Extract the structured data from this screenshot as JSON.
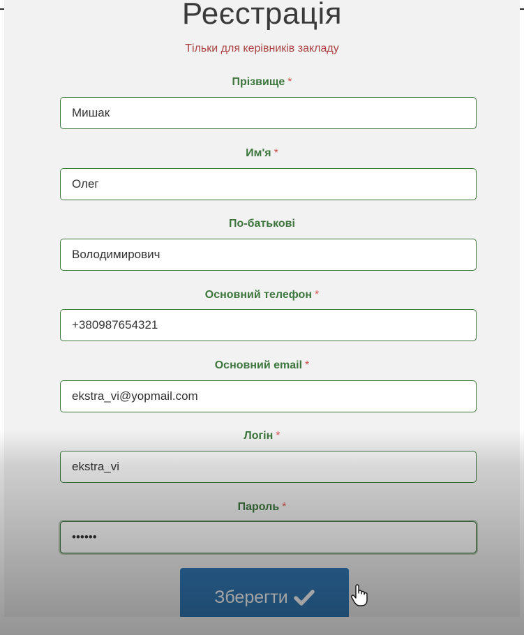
{
  "page": {
    "title": "Реєстрація",
    "subtitle": "Тільки для керівників закладу"
  },
  "form": {
    "required_mark": "*",
    "fields": [
      {
        "label": "Прізвище",
        "required": true,
        "value": "Мишак"
      },
      {
        "label": "Им'я",
        "required": true,
        "value": "Олег"
      },
      {
        "label": "По-батькові",
        "required": false,
        "value": "Володимирович"
      },
      {
        "label": "Основний телефон",
        "required": true,
        "value": "+380987654321"
      },
      {
        "label": "Основний email",
        "required": true,
        "value": "ekstra_vi@yopmail.com"
      },
      {
        "label": "Логін",
        "required": true,
        "value": "ekstra_vi"
      },
      {
        "label": "Пароль",
        "required": true,
        "value": "••••••"
      }
    ],
    "submit_label": "Зберегти"
  },
  "icons": {
    "submit": "check-icon",
    "cursor": "hand-pointer-icon"
  },
  "colors": {
    "label": "#3c763d",
    "subtitle": "#a94442",
    "required": "#d9534f",
    "button": "#337ab7"
  }
}
